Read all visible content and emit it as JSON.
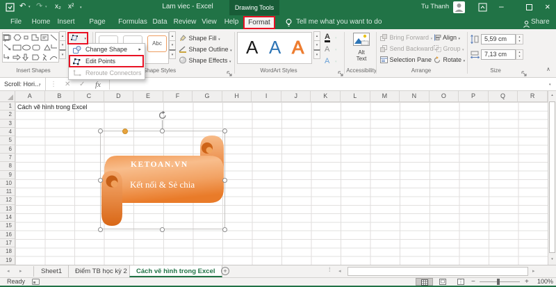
{
  "colors": {
    "excel_green": "#217346",
    "contextual_dark_green": "#185C37",
    "highlight_red": "#E81123",
    "shape_orange": "#ED7D31",
    "wordart_blue": "#2E75B6"
  },
  "icons": {
    "dropdown": "▾",
    "up": "▴",
    "submenu": "▸",
    "left": "◂",
    "right": "▸",
    "undo": "↶",
    "redo": "↷",
    "minimize": "–",
    "close": "×",
    "cancel": "✕",
    "check": "✓",
    "dots": "⋮",
    "drag_dots": "⁞",
    "minus": "−",
    "plus": "+",
    "new_sheet": "+",
    "collapse": "∧"
  },
  "title_bar": {
    "subscript_button": "x₂",
    "superscript_button": "x²",
    "document_title": "Lam viec - Excel",
    "contextual_tools": "Drawing Tools",
    "user_name": "Tu Thanh"
  },
  "tab_row": {
    "tabs": [
      "File",
      "Home",
      "Insert",
      "Page Layout",
      "Formulas",
      "Data",
      "Review",
      "View",
      "Help"
    ],
    "contextual_tab": "Format",
    "tell_me": "Tell me what you want to do",
    "share": "Share"
  },
  "ribbon": {
    "insert_shapes_label": "Insert Shapes",
    "shape_styles": {
      "label": "Shape Styles",
      "preview": "Abc",
      "fill": "Shape Fill",
      "outline": "Shape Outline",
      "effects": "Shape Effects"
    },
    "wordart": {
      "label": "WordArt Styles",
      "letter": "A"
    },
    "accessibility": {
      "label": "Accessibility",
      "alt_text_line1": "Alt",
      "alt_text_line2": "Text"
    },
    "arrange": {
      "label": "Arrange",
      "bring_forward": "Bring Forward",
      "send_backward": "Send Backward",
      "selection_pane": "Selection Pane",
      "align": "Align",
      "group": "Group",
      "rotate": "Rotate"
    },
    "size": {
      "label": "Size",
      "height": "5,59 cm",
      "width": "7,13 cm"
    }
  },
  "edit_shape_menu": {
    "change_shape": "Change Shape",
    "edit_points": "Edit Points",
    "reroute_connectors": "Reroute Connectors"
  },
  "formula_bar": {
    "name_box": "Scroll: Hori...",
    "fx_label": "fx"
  },
  "grid": {
    "columns": [
      "A",
      "B",
      "C",
      "D",
      "E",
      "F",
      "G",
      "H",
      "I",
      "J",
      "K",
      "L",
      "M",
      "N",
      "O",
      "P",
      "Q",
      "R"
    ],
    "row_labels": [
      "1",
      "2",
      "3",
      "4",
      "5",
      "6",
      "7",
      "8",
      "9",
      "10",
      "11",
      "12",
      "13",
      "14",
      "15",
      "16",
      "17",
      "18",
      "19"
    ],
    "a1_text": "Cách vẽ hình trong Excel"
  },
  "shape": {
    "line1": "KETOAN.VN",
    "line2": "Kết nối & Sẻ chia"
  },
  "sheet_tabs": {
    "tabs": [
      {
        "label": "Sheet1",
        "active": false
      },
      {
        "label": "Điểm TB học kỳ 2",
        "active": false
      },
      {
        "label": "Cách vẽ hình trong Excel",
        "active": true
      }
    ]
  },
  "status_bar": {
    "status": "Ready",
    "zoom_level": "100%"
  }
}
